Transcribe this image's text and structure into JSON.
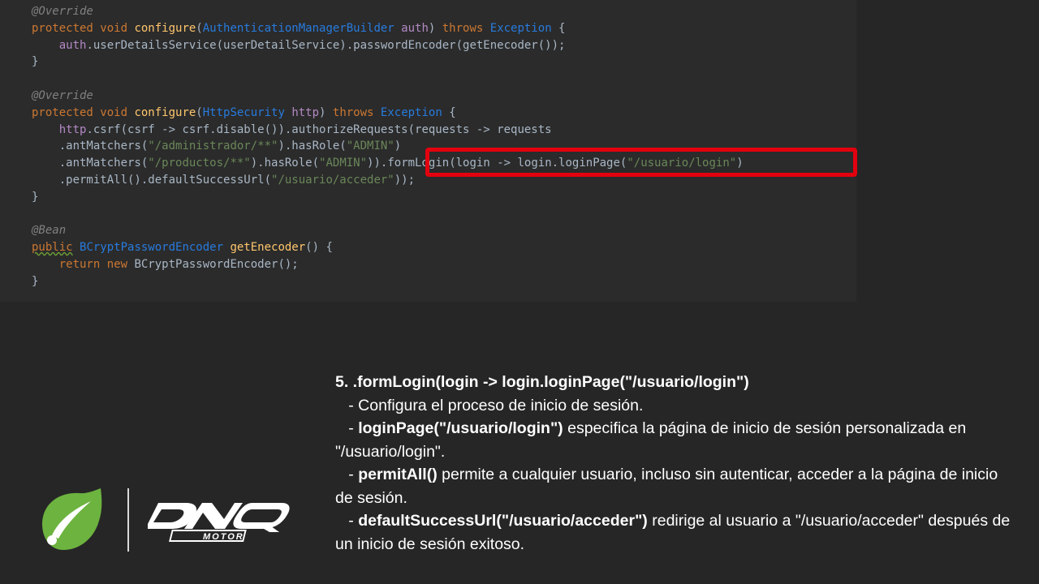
{
  "code": {
    "lines": [
      [
        {
          "c": "ann",
          "t": "@Override"
        }
      ],
      [
        {
          "c": "kw",
          "t": "protected void "
        },
        {
          "c": "fn",
          "t": "configure"
        },
        {
          "c": "plain",
          "t": "("
        },
        {
          "c": "type",
          "t": "AuthenticationManagerBuilder "
        },
        {
          "c": "param",
          "t": "auth"
        },
        {
          "c": "plain",
          "t": ") "
        },
        {
          "c": "kw",
          "t": "throws "
        },
        {
          "c": "type",
          "t": "Exception"
        },
        {
          "c": "plain",
          "t": " {"
        }
      ],
      [
        {
          "c": "plain",
          "t": "    "
        },
        {
          "c": "param",
          "t": "auth"
        },
        {
          "c": "plain",
          "t": ".userDetailsService(userDetailService).passwordEncoder(getEnecoder());"
        }
      ],
      [
        {
          "c": "plain",
          "t": "}"
        }
      ],
      [
        {
          "c": "plain",
          "t": ""
        }
      ],
      [
        {
          "c": "ann",
          "t": "@Override"
        }
      ],
      [
        {
          "c": "kw",
          "t": "protected void "
        },
        {
          "c": "fn",
          "t": "configure"
        },
        {
          "c": "plain",
          "t": "("
        },
        {
          "c": "type",
          "t": "HttpSecurity "
        },
        {
          "c": "param",
          "t": "http"
        },
        {
          "c": "plain",
          "t": ") "
        },
        {
          "c": "kw",
          "t": "throws "
        },
        {
          "c": "type",
          "t": "Exception"
        },
        {
          "c": "plain",
          "t": " {"
        }
      ],
      [
        {
          "c": "plain",
          "t": "    "
        },
        {
          "c": "param",
          "t": "http"
        },
        {
          "c": "plain",
          "t": ".csrf(csrf -> csrf.disable()).authorizeRequests(requests -> requests"
        }
      ],
      [
        {
          "c": "plain",
          "t": "    .antMatchers("
        },
        {
          "c": "str",
          "t": "\"/administrador/**\""
        },
        {
          "c": "plain",
          "t": ").hasRole("
        },
        {
          "c": "str",
          "t": "\"ADMIN\""
        },
        {
          "c": "plain",
          "t": ")"
        }
      ],
      [
        {
          "c": "plain",
          "t": "    .antMatchers("
        },
        {
          "c": "str",
          "t": "\"/productos/**\""
        },
        {
          "c": "plain",
          "t": ").hasRole("
        },
        {
          "c": "str",
          "t": "\"ADMIN\""
        },
        {
          "c": "plain",
          "t": ")).formLogin(login -> login.loginPage("
        },
        {
          "c": "str",
          "t": "\"/usuario/login\""
        },
        {
          "c": "plain",
          "t": ")"
        }
      ],
      [
        {
          "c": "plain",
          "t": "    .permitAll().defaultSuccessUrl("
        },
        {
          "c": "str",
          "t": "\"/usuario/acceder\""
        },
        {
          "c": "plain",
          "t": "));"
        }
      ],
      [
        {
          "c": "plain",
          "t": "}"
        }
      ],
      [
        {
          "c": "plain",
          "t": ""
        }
      ],
      [
        {
          "c": "ann",
          "t": "@Bean"
        }
      ],
      [
        {
          "c": "kw squiggle",
          "t": "public"
        },
        {
          "c": "plain",
          "t": " "
        },
        {
          "c": "type",
          "t": "BCryptPasswordEncoder "
        },
        {
          "c": "fn",
          "t": "getEnecoder"
        },
        {
          "c": "plain",
          "t": "() {"
        }
      ],
      [
        {
          "c": "plain",
          "t": "    "
        },
        {
          "c": "kw",
          "t": "return new "
        },
        {
          "c": "plain",
          "t": "BCryptPasswordEncoder();"
        }
      ],
      [
        {
          "c": "plain",
          "t": "}"
        }
      ]
    ]
  },
  "explanation": {
    "heading": "5. .formLogin(login -> login.loginPage(\"/usuario/login\")",
    "b1_text": "   - Configura el proceso de inicio de sesión.",
    "b2_prefix": "   - ",
    "b2_bold": "loginPage(\"/usuario/login\")",
    "b2_rest": " especifica la página de inicio de sesión personalizada en \"/usuario/login\".",
    "b3_prefix": "   - ",
    "b3_bold": "permitAll()",
    "b3_rest": " permite a cualquier usuario, incluso sin autenticar, acceder a la página de inicio de sesión.",
    "b4_prefix": "   - ",
    "b4_bold": "defaultSuccessUrl(\"/usuario/acceder\")",
    "b4_rest": " redirige al usuario a \"/usuario/acceder\" después de un inicio de sesión exitoso."
  },
  "logos": {
    "spring_color": "#6db33f",
    "dnq_main": "DNQ",
    "dnq_sub": "MOTOR"
  },
  "colors": {
    "highlight": "#e3000f",
    "background": "#262626",
    "code_background": "#2b2b2b"
  }
}
